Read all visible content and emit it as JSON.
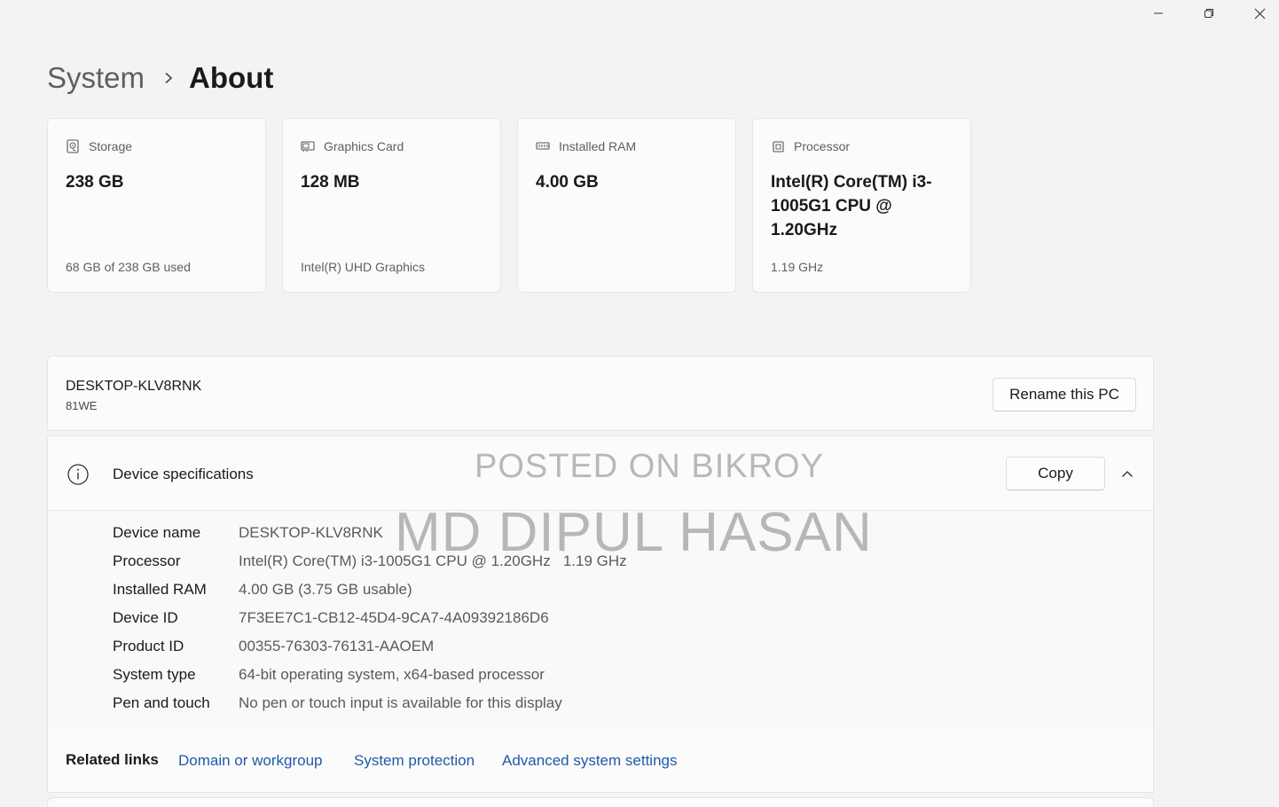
{
  "breadcrumb": {
    "parent": "System",
    "current": "About"
  },
  "cards": [
    {
      "icon": "storage-icon",
      "label": "Storage",
      "value": "238 GB",
      "foot": "68 GB of 238 GB used"
    },
    {
      "icon": "graphics-card-icon",
      "label": "Graphics Card",
      "value": "128 MB",
      "foot": "Intel(R) UHD Graphics"
    },
    {
      "icon": "ram-icon",
      "label": "Installed RAM",
      "value": "4.00 GB",
      "foot": ""
    },
    {
      "icon": "processor-icon",
      "label": "Processor",
      "value": "Intel(R) Core(TM) i3-1005G1 CPU @ 1.20GHz",
      "foot": "1.19 GHz"
    }
  ],
  "pc": {
    "name": "DESKTOP-KLV8RNK",
    "model": "81WE",
    "rename_label": "Rename this PC"
  },
  "specs": {
    "title": "Device specifications",
    "copy_label": "Copy",
    "rows": [
      {
        "key": "Device name",
        "value": "DESKTOP-KLV8RNK"
      },
      {
        "key": "Processor",
        "value": "Intel(R) Core(TM) i3-1005G1 CPU @ 1.20GHz   1.19 GHz"
      },
      {
        "key": "Installed RAM",
        "value": "4.00 GB (3.75 GB usable)"
      },
      {
        "key": "Device ID",
        "value": "7F3EE7C1-CB12-45D4-9CA7-4A09392186D6"
      },
      {
        "key": "Product ID",
        "value": "00355-76303-76131-AAOEM"
      },
      {
        "key": "System type",
        "value": "64-bit operating system, x64-based processor"
      },
      {
        "key": "Pen and touch",
        "value": "No pen or touch input is available for this display"
      }
    ]
  },
  "related": {
    "title": "Related links",
    "links": [
      "Domain or workgroup",
      "System protection",
      "Advanced system settings"
    ]
  },
  "watermark": {
    "line1": "POSTED ON BIKROY",
    "line2": "MD DIPUL HASAN"
  },
  "colors": {
    "background": "#f3f3f3",
    "card": "#fbfbfb",
    "link": "#1f5aa8"
  }
}
